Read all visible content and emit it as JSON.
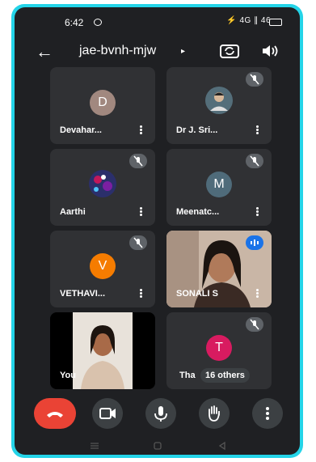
{
  "status_bar": {
    "time": "6:42",
    "right_text": "⚡ 4G ∥ 46"
  },
  "top_bar": {
    "meeting_code": "jae-bvnh-mjw",
    "caret": "▸"
  },
  "tiles": [
    {
      "name": "Devahar...",
      "initial": "D",
      "avatar_color": "#a1887f",
      "muted": false
    },
    {
      "name": "Dr J. Sri...",
      "initial": "",
      "avatar_color": "#546e7a",
      "muted": true
    },
    {
      "name": "Aarthi",
      "initial": "",
      "avatar_color": "#3a3f7a",
      "muted": true
    },
    {
      "name": "Meenatc...",
      "initial": "M",
      "avatar_color": "#4f6b7a",
      "muted": true
    },
    {
      "name": "VETHAVI...",
      "initial": "V",
      "avatar_color": "#f57c00",
      "muted": true
    },
    {
      "name": "SONALI S",
      "initial": "",
      "avatar_color": "",
      "muted": false,
      "speaking": true
    },
    {
      "name": "You",
      "initial": "",
      "avatar_color": "",
      "muted": false
    },
    {
      "name": "Tha",
      "initial": "T",
      "avatar_color": "#d81b60",
      "muted": true,
      "overlay": "16 others"
    }
  ],
  "controls": {
    "end_color": "#ea4335",
    "button_color": "#3c4043"
  },
  "accent": "#24d4e8"
}
